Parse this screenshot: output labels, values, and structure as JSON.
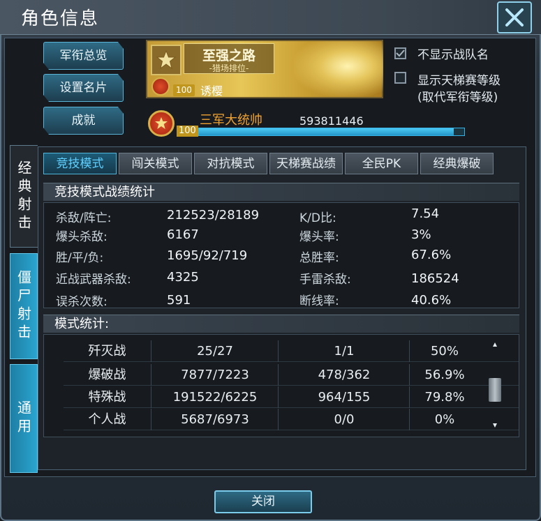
{
  "window": {
    "title": "角色信息"
  },
  "side_buttons": [
    "军衔总览",
    "设置名片",
    "成就"
  ],
  "banner": {
    "title": "至强之路",
    "subtitle": "-猎场排位-",
    "level": "100",
    "name": "诱樱"
  },
  "options": [
    {
      "label": "不显示战队名",
      "checked": true
    },
    {
      "label": "显示天梯赛等级",
      "label2": "(取代军衔等级)",
      "checked": false
    }
  ],
  "rank": {
    "level": "100",
    "title": "三军大统帅",
    "id": "593811446",
    "progress_fraction": 0.96
  },
  "vertical_tabs": [
    "经典射击",
    "僵尸射击",
    "通用"
  ],
  "mode_tabs": [
    "竞技模式",
    "闯关模式",
    "对抗模式",
    "天梯赛战绩",
    "全民PK",
    "经典爆破"
  ],
  "stats": {
    "heading": "竞技模式战绩统计",
    "rows": [
      {
        "l1": "杀敌/阵亡:",
        "v1": "212523/28189",
        "l2": "K/D比:",
        "v2": "7.54"
      },
      {
        "l1": "爆头杀敌:",
        "v1": "6167",
        "l2": "爆头率:",
        "v2": "3%"
      },
      {
        "l1": "胜/平/负:",
        "v1": "1695/92/719",
        "l2": "总胜率:",
        "v2": "67.6%"
      },
      {
        "l1": "近战武器杀敌:",
        "v1": "4325",
        "l2": "手雷杀敌:",
        "v2": "186524"
      },
      {
        "l1": "误杀次数:",
        "v1": "591",
        "l2": "断线率:",
        "v2": "40.6%"
      }
    ]
  },
  "mode_stats": {
    "heading": "模式统计:",
    "rows": [
      [
        "歼灭战",
        "25/27",
        "1/1",
        "50%"
      ],
      [
        "爆破战",
        "7877/7223",
        "478/362",
        "56.9%"
      ],
      [
        "特殊战",
        "191522/6225",
        "964/155",
        "79.8%"
      ],
      [
        "个人战",
        "5687/6973",
        "0/0",
        "0%"
      ]
    ]
  },
  "footer": {
    "close_label": "关闭"
  },
  "colors": {
    "accent": "#33b3e8",
    "rank_title": "#f0a230"
  }
}
